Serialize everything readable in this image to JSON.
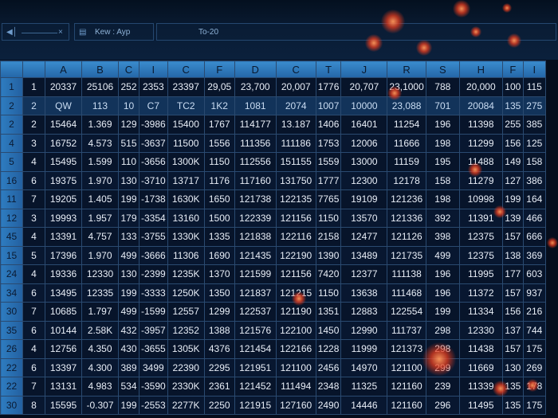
{
  "toolbar": {
    "close_glyph": "×",
    "box2_text": "Kew : Ayp",
    "formula_text": "To-20"
  },
  "columns": [
    "A",
    "B",
    "C",
    "I",
    "C",
    "F",
    "D",
    "C",
    "T",
    "J",
    "R",
    "S",
    "H",
    "F",
    "I"
  ],
  "rows": [
    {
      "h": "1",
      "c": [
        "1",
        "20337",
        "25106",
        "252",
        "2353",
        "23397",
        "29,05",
        "23,700",
        "20,007",
        "1776",
        "20,707",
        "23,1000",
        "788",
        "20,000",
        "100",
        "115"
      ]
    },
    {
      "h": "2",
      "sel": true,
      "c": [
        "2",
        "QW",
        "113",
        "10",
        "C7",
        "TC2",
        "1K2",
        "1081",
        "2074",
        "1007",
        "10000",
        "23,088",
        "701",
        "20084",
        "135",
        "275"
      ]
    },
    {
      "h": "2",
      "c": [
        "2",
        "15464",
        "1.369",
        "129",
        "-3986",
        "15400",
        "1767",
        "114177",
        "13.187",
        "1406",
        "16401",
        "11254",
        "196",
        "11398",
        "255",
        "385"
      ]
    },
    {
      "h": "4",
      "c": [
        "3",
        "16752",
        "4.573",
        "515",
        "-3637",
        "11500",
        "1556",
        "111356",
        "111186",
        "1753",
        "12006",
        "11666",
        "198",
        "11299",
        "156",
        "125"
      ]
    },
    {
      "h": "5",
      "c": [
        "4",
        "15495",
        "1.599",
        "110",
        "-3656",
        "1300K",
        "1150",
        "112556",
        "151155",
        "1559",
        "13000",
        "11159",
        "195",
        "11488",
        "149",
        "158"
      ]
    },
    {
      "h": "16",
      "c": [
        "6",
        "19375",
        "1.970",
        "130",
        "-3710",
        "13717",
        "1176",
        "117160",
        "131750",
        "1777",
        "12300",
        "12178",
        "158",
        "11279",
        "127",
        "386"
      ]
    },
    {
      "h": "11",
      "c": [
        "7",
        "19205",
        "1.405",
        "199",
        "-1738",
        "1630K",
        "1650",
        "121738",
        "122135",
        "7765",
        "19109",
        "121236",
        "198",
        "10998",
        "199",
        "164"
      ]
    },
    {
      "h": "12",
      "c": [
        "3",
        "19993",
        "1.957",
        "179",
        "-3354",
        "13160",
        "1500",
        "122339",
        "121156",
        "1150",
        "13570",
        "121336",
        "392",
        "11391",
        "139",
        "466"
      ]
    },
    {
      "h": "45",
      "c": [
        "4",
        "13391",
        "4.757",
        "133",
        "-3755",
        "1330K",
        "1335",
        "121838",
        "122116",
        "2158",
        "12477",
        "121126",
        "398",
        "12375",
        "157",
        "666"
      ]
    },
    {
      "h": "15",
      "c": [
        "5",
        "17396",
        "1.970",
        "499",
        "-3666",
        "11306",
        "1690",
        "121435",
        "122190",
        "1390",
        "13489",
        "121735",
        "499",
        "12375",
        "138",
        "369"
      ]
    },
    {
      "h": "24",
      "c": [
        "4",
        "19336",
        "12330",
        "130",
        "-2399",
        "1235K",
        "1370",
        "121599",
        "121156",
        "7420",
        "12377",
        "111138",
        "196",
        "11995",
        "177",
        "603"
      ]
    },
    {
      "h": "34",
      "c": [
        "6",
        "13495",
        "12335",
        "199",
        "-3333",
        "1250K",
        "1350",
        "121837",
        "121215",
        "1150",
        "13638",
        "111468",
        "196",
        "11372",
        "157",
        "937"
      ]
    },
    {
      "h": "30",
      "c": [
        "7",
        "10685",
        "1.797",
        "499",
        "-1599",
        "12557",
        "1299",
        "122537",
        "121190",
        "1351",
        "12883",
        "122554",
        "199",
        "11334",
        "156",
        "216"
      ]
    },
    {
      "h": "35",
      "c": [
        "6",
        "10144",
        "2.58K",
        "432",
        "-3957",
        "12352",
        "1388",
        "121576",
        "122100",
        "1450",
        "12990",
        "111737",
        "298",
        "12330",
        "137",
        "744"
      ]
    },
    {
      "h": "26",
      "c": [
        "4",
        "12756",
        "4.350",
        "430",
        "-3655",
        "1305K",
        "4376",
        "121454",
        "122166",
        "1228",
        "11999",
        "121373",
        "298",
        "11438",
        "157",
        "175"
      ]
    },
    {
      "h": "22",
      "c": [
        "6",
        "13397",
        "4.300",
        "389",
        "3499",
        "22390",
        "2295",
        "121951",
        "121100",
        "2456",
        "14970",
        "121100",
        "299",
        "11669",
        "130",
        "269"
      ]
    },
    {
      "h": "22",
      "c": [
        "7",
        "13131",
        "4.983",
        "534",
        "-3590",
        "2330K",
        "2361",
        "121452",
        "111494",
        "2348",
        "11325",
        "121160",
        "239",
        "11339",
        "135",
        "178"
      ]
    },
    {
      "h": "30",
      "c": [
        "8",
        "15595",
        "-0.307",
        "199",
        "-2553",
        "2277K",
        "2250",
        "121915",
        "127160",
        "2490",
        "14446",
        "121160",
        "296",
        "11495",
        "135",
        "175"
      ]
    }
  ],
  "colors": {
    "background": "#050d1c",
    "header_blue": "#2e7cc0",
    "cell_bg": "#07142a",
    "grid_line": "#2a4a70",
    "glow": "#ff5a2a"
  }
}
